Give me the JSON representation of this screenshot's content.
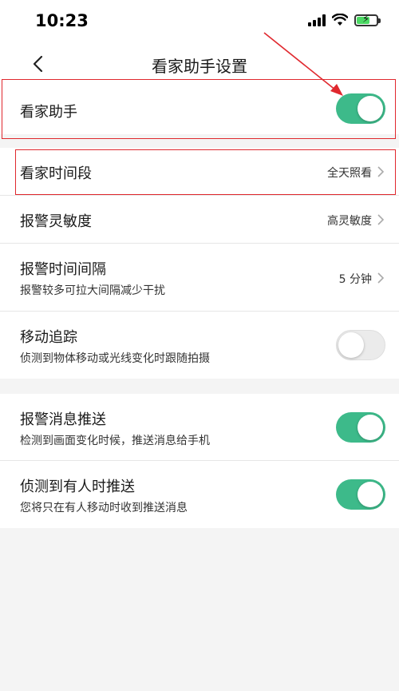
{
  "status_bar": {
    "time": "10:23",
    "icons": [
      "signal-icon",
      "wifi-icon",
      "battery-charging-icon"
    ],
    "battery_color": "#4cd964"
  },
  "nav": {
    "back_icon": "chevron-left-icon",
    "title": "看家助手设置"
  },
  "groups": [
    {
      "rows": [
        {
          "title": "看家助手",
          "toggle": true
        }
      ]
    },
    {
      "rows": [
        {
          "title": "看家时间段",
          "value": "全天照看"
        },
        {
          "title": "报警灵敏度",
          "value": "高灵敏度"
        },
        {
          "title": "报警时间间隔",
          "subtitle": "报警较多可拉大间隔减少干扰",
          "value": "5 分钟"
        },
        {
          "title": "移动追踪",
          "subtitle": "侦测到物体移动或光线变化时跟随拍摄",
          "toggle": false
        }
      ]
    },
    {
      "rows": [
        {
          "title": "报警消息推送",
          "subtitle": "检测到画面变化时候，推送消息给手机",
          "toggle": true
        },
        {
          "title": "侦测到有人时推送",
          "subtitle": "您将只在有人移动时收到推送消息",
          "toggle": true
        }
      ]
    }
  ],
  "colors": {
    "toggle_on": "#3dba8a",
    "toggle_off": "#ebebeb",
    "annotation": "#e0282e",
    "background": "#f4f4f4"
  }
}
